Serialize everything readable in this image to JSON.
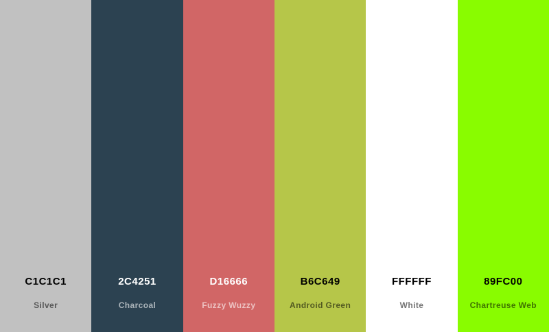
{
  "swatches": [
    {
      "hex": "C1C1C1",
      "name": "Silver",
      "color": "#C1C1C1",
      "text": "light"
    },
    {
      "hex": "2C4251",
      "name": "Charcoal",
      "color": "#2C4251",
      "text": "dark"
    },
    {
      "hex": "D16666",
      "name": "Fuzzy Wuzzy",
      "color": "#D16666",
      "text": "dark"
    },
    {
      "hex": "B6C649",
      "name": "Android Green",
      "color": "#B6C649",
      "text": "light"
    },
    {
      "hex": "FFFFFF",
      "name": "White",
      "color": "#FFFFFF",
      "text": "light"
    },
    {
      "hex": "89FC00",
      "name": "Chartreuse Web",
      "color": "#89FC00",
      "text": "light"
    }
  ]
}
